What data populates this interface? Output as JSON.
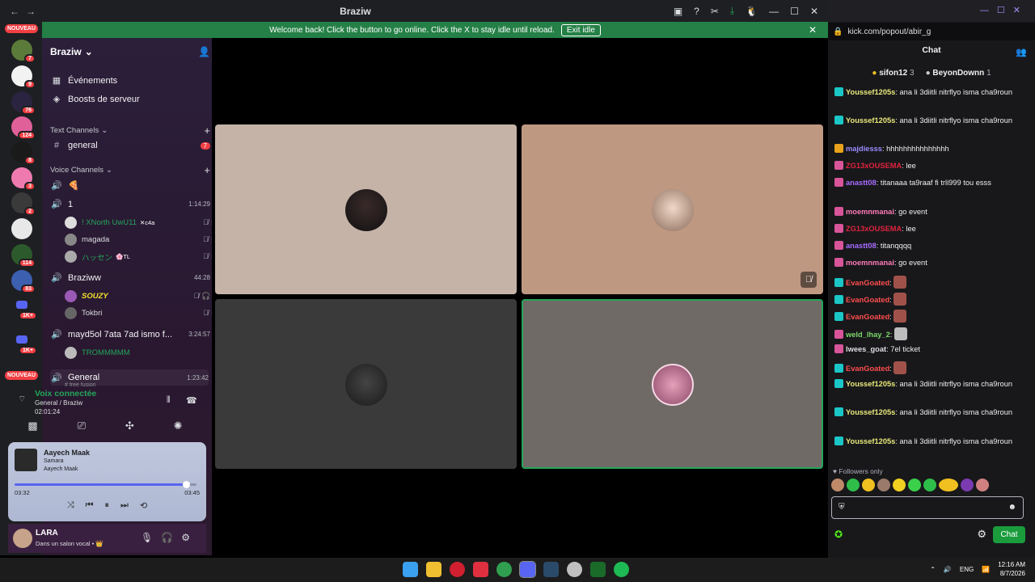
{
  "window": {
    "title": "Braziw",
    "nav_back": "←",
    "nav_forward": "→",
    "tools": [
      "▣",
      "?",
      "✂",
      "⤓",
      "🐧",
      "—",
      "☐",
      "✕"
    ]
  },
  "banner": {
    "text": "Welcome back! Click the button to go online. Click the X to stay idle until reload.",
    "button": "Exit idle",
    "close": "✕"
  },
  "rail": {
    "new_tag_top": "NOUVEAU",
    "new_tag_bottom": "NOUVEAU",
    "badges": [
      "7",
      "9",
      "76",
      "124",
      "8",
      "3",
      "2",
      "114",
      "83",
      "1K+",
      "1K+"
    ]
  },
  "sidebar": {
    "guild_name": "Braziw",
    "guild_chevron": "⌄",
    "events": "Événements",
    "boosts": "Boosts de serveur",
    "text_category": "Text Channels",
    "general_channel": "general",
    "general_unread": "7",
    "voice_category": "Voice Channels",
    "channels": [
      {
        "name": "1",
        "time": "1:14:29"
      },
      {
        "name": "Braziww",
        "time": "44:28"
      },
      {
        "name": "mayd5ol 7ata 7ad ismo f...",
        "time": "3:24:57"
      },
      {
        "name": "General",
        "time": "1:23:42"
      }
    ],
    "users": [
      {
        "name": "! XNorth UwU11",
        "tag": "✕c4a"
      },
      {
        "name": "magada",
        "tag": ""
      },
      {
        "name": "ハッセン",
        "tag": "🌸TL"
      },
      {
        "name": "SOUZY",
        "tag": ""
      },
      {
        "name": "Tokbri",
        "tag": ""
      },
      {
        "name": "TROMMMMM",
        "tag": ""
      }
    ],
    "partial_text": "# free fusion"
  },
  "voice": {
    "status": "Voix connectée",
    "channel": "General / Braziw",
    "duration": "02:01:24"
  },
  "music": {
    "title": "Aayech Maak",
    "artist": "Samara",
    "album": "Aayech Maak",
    "elapsed": "03:32",
    "total": "03:45",
    "progress": 0.94
  },
  "userbar": {
    "name": "LARA",
    "status": "Dans un salon vocal • 👑"
  },
  "chat": {
    "url": "kick.com/popout/abir_g",
    "header": "Chat",
    "gifters": [
      {
        "name": "sifon12",
        "count": "3"
      },
      {
        "name": "BeyonDownn",
        "count": "1"
      }
    ],
    "messages": [
      {
        "user": "Youssef1205s",
        "color": "#e8e87a",
        "text": "ana li 3diitli nitrflyo isma cha9roun",
        "badge": "#1bc6c6"
      },
      {
        "user": "Youssef1205s",
        "color": "#e8e87a",
        "text": "ana li 3diitli nitrflyo isma cha9roun",
        "badge": "#1bc6c6"
      },
      {
        "user": "majdiesss",
        "color": "#9a8cff",
        "text": "hhhhhhhhhhhhhhh",
        "badge": "#e8a21b"
      },
      {
        "user": "ZG13xOUSEMA",
        "color": "#e0233c",
        "text": "lee",
        "badge": "#d9559a"
      },
      {
        "user": "anastt08",
        "color": "#a66cff",
        "text": "titanaaa ta9raaf fi trli999 tou esss",
        "badge": "#d9559a"
      },
      {
        "user": "moemnmanai",
        "color": "#ff7ab8",
        "text": "go event",
        "badge": "#d9559a"
      },
      {
        "user": "ZG13xOUSEMA",
        "color": "#e0233c",
        "text": "lee",
        "badge": "#d9559a"
      },
      {
        "user": "anastt08",
        "color": "#a66cff",
        "text": "titanqqqq",
        "badge": "#d9559a"
      },
      {
        "user": "moemnmanai",
        "color": "#ff7ab8",
        "text": "go event",
        "badge": "#d9559a"
      },
      {
        "user": "EvanGoated",
        "color": "#ff4d4d",
        "text": "",
        "badge": "#1bc6c6"
      },
      {
        "user": "EvanGoated",
        "color": "#ff4d4d",
        "text": "",
        "badge": "#1bc6c6"
      },
      {
        "user": "EvanGoated",
        "color": "#ff4d4d",
        "text": "",
        "badge": "#1bc6c6"
      },
      {
        "user": "weld_lhay_2",
        "color": "#7cd66a",
        "text": "",
        "badge": "#d9559a"
      },
      {
        "user": "lwees_goat",
        "color": "#dedee3",
        "text": "7el ticket",
        "badge": "#d9559a"
      },
      {
        "user": "EvanGoated",
        "color": "#ff4d4d",
        "text": "",
        "badge": "#1bc6c6"
      },
      {
        "user": "Youssef1205s",
        "color": "#e8e87a",
        "text": "ana li 3diitli nitrflyo isma cha9roun",
        "badge": "#1bc6c6"
      },
      {
        "user": "Youssef1205s",
        "color": "#e8e87a",
        "text": "ana li 3diitli nitrflyo isma cha9roun",
        "badge": "#1bc6c6"
      },
      {
        "user": "Youssef1205s",
        "color": "#e8e87a",
        "text": "ana li 3diitli nitrflyo isma cha9roun",
        "badge": "#1bc6c6"
      }
    ],
    "followers_only": "Followers only",
    "send": "Chat"
  },
  "taskbar": {
    "lang": "ENG",
    "time": "12:16 AM",
    "date": "8/7/2026"
  },
  "colors": {
    "banner": "#248046",
    "sidebar": "#2b1f3a",
    "speaking": "#23a55a",
    "chat_send": "#1a9c3c"
  }
}
